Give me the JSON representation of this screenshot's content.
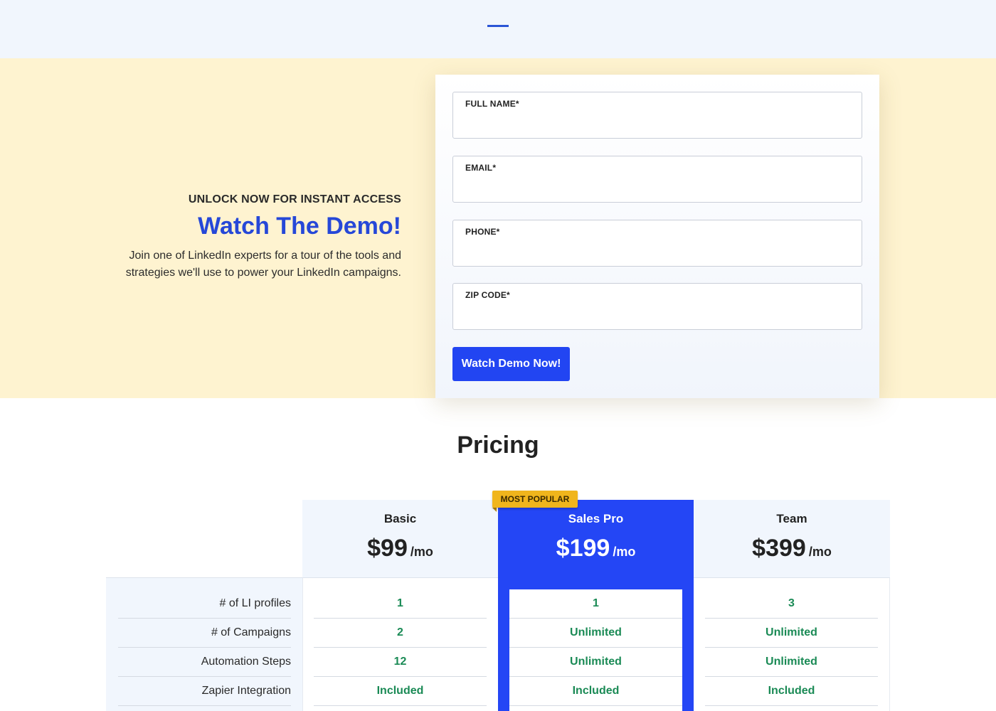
{
  "hero": {
    "eyebrow": "UNLOCK NOW FOR INSTANT ACCESS",
    "title": "Watch The Demo!",
    "description_line1": "Join one of LinkedIn experts for a tour of the tools and",
    "description_line2": "strategies we'll use to power your LinkedIn campaigns."
  },
  "form": {
    "fields": [
      {
        "label": "FULL NAME*",
        "value": "",
        "placeholder": ""
      },
      {
        "label": "EMAIL*",
        "value": "",
        "placeholder": ""
      },
      {
        "label": "PHONE*",
        "value": "",
        "placeholder": ""
      },
      {
        "label": "ZIP CODE*",
        "value": "",
        "placeholder": ""
      }
    ],
    "submit_label": "Watch Demo Now!"
  },
  "pricing": {
    "title": "Pricing",
    "badge": "MOST POPULAR",
    "plans": [
      {
        "name": "Basic",
        "price": "$99",
        "period": "/mo"
      },
      {
        "name": "Sales Pro",
        "price": "$199",
        "period": "/mo"
      },
      {
        "name": "Team",
        "price": "$399",
        "period": "/mo"
      }
    ],
    "features": [
      {
        "label": "# of LI profiles",
        "values": [
          "1",
          "1",
          "3"
        ]
      },
      {
        "label": "# of Campaigns",
        "values": [
          "2",
          "Unlimited",
          "Unlimited"
        ]
      },
      {
        "label": "Automation Steps",
        "values": [
          "12",
          "Unlimited",
          "Unlimited"
        ]
      },
      {
        "label": "Zapier Integration",
        "values": [
          "Included",
          "Included",
          "Included"
        ]
      }
    ]
  },
  "colors": {
    "accent_blue": "#2446f5",
    "title_blue": "#2648d8",
    "hero_bg": "#fef3d0",
    "badge": "#f0b51c",
    "value_green": "#1a8a55"
  }
}
